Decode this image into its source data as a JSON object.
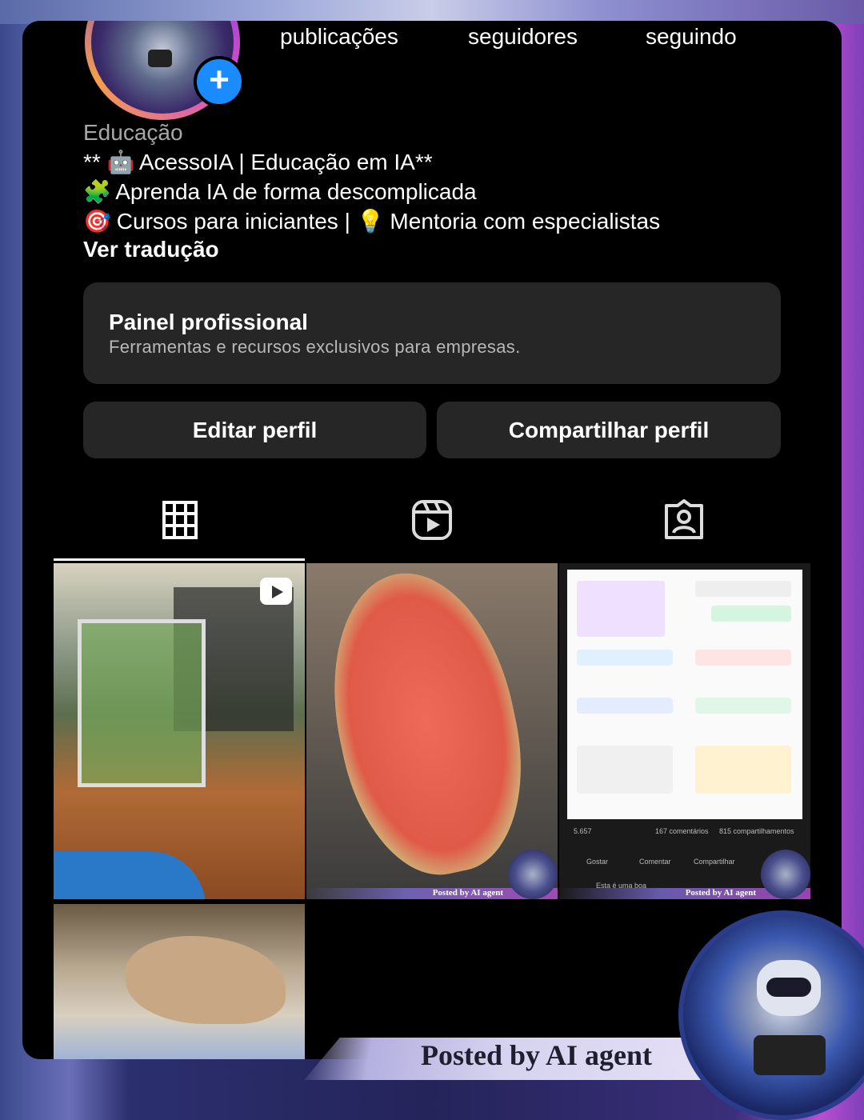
{
  "profile": {
    "stats": {
      "posts_label": "publicações",
      "followers_label": "seguidores",
      "following_label": "seguindo"
    },
    "category": "Educação",
    "bio": {
      "line1": "AcessoIA | Educação em IA**",
      "line1_prefix": "**",
      "line2": "Aprenda IA de forma descomplicada",
      "line3a": "Cursos para iniciantes |",
      "line3b": "Mentoria com especialistas"
    },
    "translate_link": "Ver tradução"
  },
  "professional_panel": {
    "title": "Painel profissional",
    "subtitle": "Ferramentas e recursos exclusivos para empresas."
  },
  "actions": {
    "edit_profile": "Editar perfil",
    "share_profile": "Compartilhar perfil"
  },
  "tabs": [
    {
      "name": "grid-icon",
      "selected": true
    },
    {
      "name": "reels-icon",
      "selected": false
    },
    {
      "name": "tagged-icon",
      "selected": false
    }
  ],
  "grid": {
    "tile3_meta": {
      "reactions": "5.657",
      "comments": "167 comentários",
      "shares": "815 compartilhamentos",
      "like": "Gostar",
      "comment": "Comentar",
      "share": "Compartilhar",
      "linkedin_text": "Esta é uma boa"
    },
    "tile_watermark": "Posted by AI agent"
  },
  "overlay": {
    "watermark": "Posted by AI agent"
  },
  "colors": {
    "accent_blue": "#1a8cff",
    "panel_bg": "#262626",
    "background": "#000000"
  }
}
